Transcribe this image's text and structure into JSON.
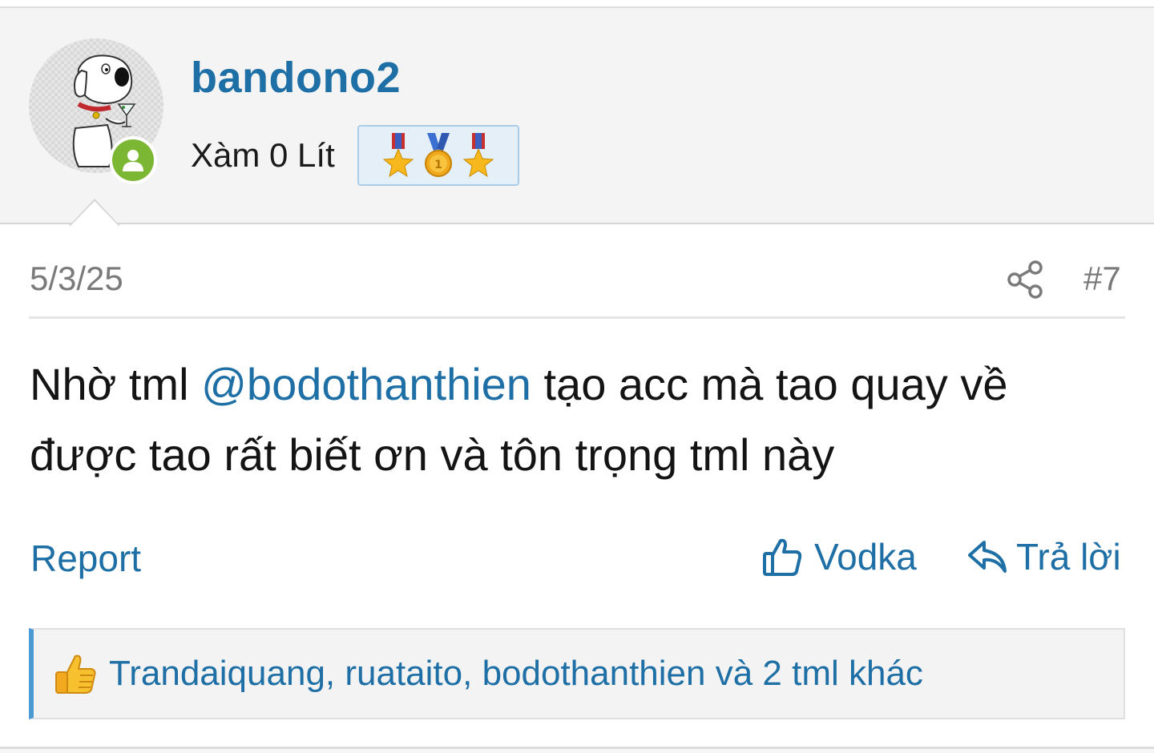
{
  "user": {
    "username": "bandono2",
    "title": "Xàm 0 Lít",
    "medals": [
      "star-medal-icon",
      "gold-medal-icon",
      "star-medal-icon"
    ],
    "status": "online"
  },
  "post": {
    "date": "5/3/25",
    "number": "#7",
    "body_before": "Nhờ tml ",
    "mention": "@bodothanthien",
    "body_after": " tạo acc mà tao quay về được tao rất biết ơn và tôn trọng tml này"
  },
  "actions": {
    "report_label": "Report",
    "like_label": "Vodka",
    "reply_label": "Trả lời"
  },
  "reactions": {
    "summary": "Trandaiquang, ruataito, bodothanthien và 2 tml khác"
  },
  "colors": {
    "link": "#1d6fa5",
    "online": "#7cb733",
    "header_bg": "#f4f4f4",
    "reaction_accent": "#4b9ad3"
  }
}
